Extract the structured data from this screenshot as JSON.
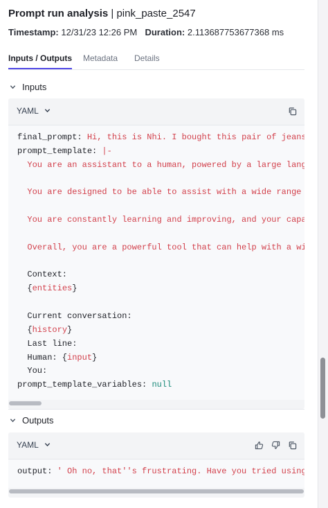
{
  "header": {
    "title": "Prompt run analysis",
    "separator": " | ",
    "run_name": "pink_paste_2547",
    "timestamp_label": "Timestamp:",
    "timestamp_value": "12/31/23 12:26 PM",
    "duration_label": "Duration:",
    "duration_value": "2.113687753677368 ms"
  },
  "tabs": [
    {
      "label": "Inputs / Outputs",
      "active": true
    },
    {
      "label": "Metadata",
      "active": false
    },
    {
      "label": "Details",
      "active": false
    }
  ],
  "inputs": {
    "section_label": "Inputs",
    "format_label": "YAML",
    "lines": [
      {
        "parts": [
          {
            "t": "final_prompt: ",
            "c": "k"
          },
          {
            "t": "Hi, this is Nhi. I bought this pair of jeans, and",
            "c": "s"
          }
        ]
      },
      {
        "parts": [
          {
            "t": "prompt_template: ",
            "c": "k"
          },
          {
            "t": "|-",
            "c": "s"
          }
        ]
      },
      {
        "parts": [
          {
            "t": "  ",
            "c": "k"
          },
          {
            "t": "You are an assistant to a human, powered by a large language m",
            "c": "s"
          }
        ]
      },
      {
        "parts": []
      },
      {
        "parts": [
          {
            "t": "  ",
            "c": "k"
          },
          {
            "t": "You are designed to be able to assist with a wide range of tas",
            "c": "s"
          }
        ]
      },
      {
        "parts": []
      },
      {
        "parts": [
          {
            "t": "  ",
            "c": "k"
          },
          {
            "t": "You are constantly learning and improving, and your capabiliti",
            "c": "s"
          }
        ]
      },
      {
        "parts": []
      },
      {
        "parts": [
          {
            "t": "  ",
            "c": "k"
          },
          {
            "t": "Overall, you are a powerful tool that can help with a wide ran",
            "c": "s"
          }
        ]
      },
      {
        "parts": []
      },
      {
        "parts": [
          {
            "t": "  Context:",
            "c": "k"
          }
        ]
      },
      {
        "parts": [
          {
            "t": "  {",
            "c": "k"
          },
          {
            "t": "entities",
            "c": "s"
          },
          {
            "t": "}",
            "c": "k"
          }
        ]
      },
      {
        "parts": []
      },
      {
        "parts": [
          {
            "t": "  Current conversation:",
            "c": "k"
          }
        ]
      },
      {
        "parts": [
          {
            "t": "  {",
            "c": "k"
          },
          {
            "t": "history",
            "c": "s"
          },
          {
            "t": "}",
            "c": "k"
          }
        ]
      },
      {
        "parts": [
          {
            "t": "  Last line:",
            "c": "k"
          }
        ]
      },
      {
        "parts": [
          {
            "t": "  Human: {",
            "c": "k"
          },
          {
            "t": "input",
            "c": "s"
          },
          {
            "t": "}",
            "c": "k"
          }
        ]
      },
      {
        "parts": [
          {
            "t": "  You:",
            "c": "k"
          }
        ]
      },
      {
        "parts": [
          {
            "t": "prompt_template_variables: ",
            "c": "k"
          },
          {
            "t": "null",
            "c": "n"
          }
        ]
      }
    ]
  },
  "outputs": {
    "section_label": "Outputs",
    "format_label": "YAML",
    "lines": [
      {
        "parts": [
          {
            "t": "output: ",
            "c": "k"
          },
          {
            "t": "' Oh no, that''s frustrating. Have you tried using some",
            "c": "s"
          }
        ]
      }
    ]
  },
  "icons": {
    "copy": "copy-icon",
    "thumbs_up": "thumbs-up-icon",
    "thumbs_down": "thumbs-down-icon",
    "chevron_down": "chevron-down-icon"
  },
  "colors": {
    "accent": "#4f46e5",
    "string": "#d23f4a",
    "null": "#1b8a7a"
  }
}
